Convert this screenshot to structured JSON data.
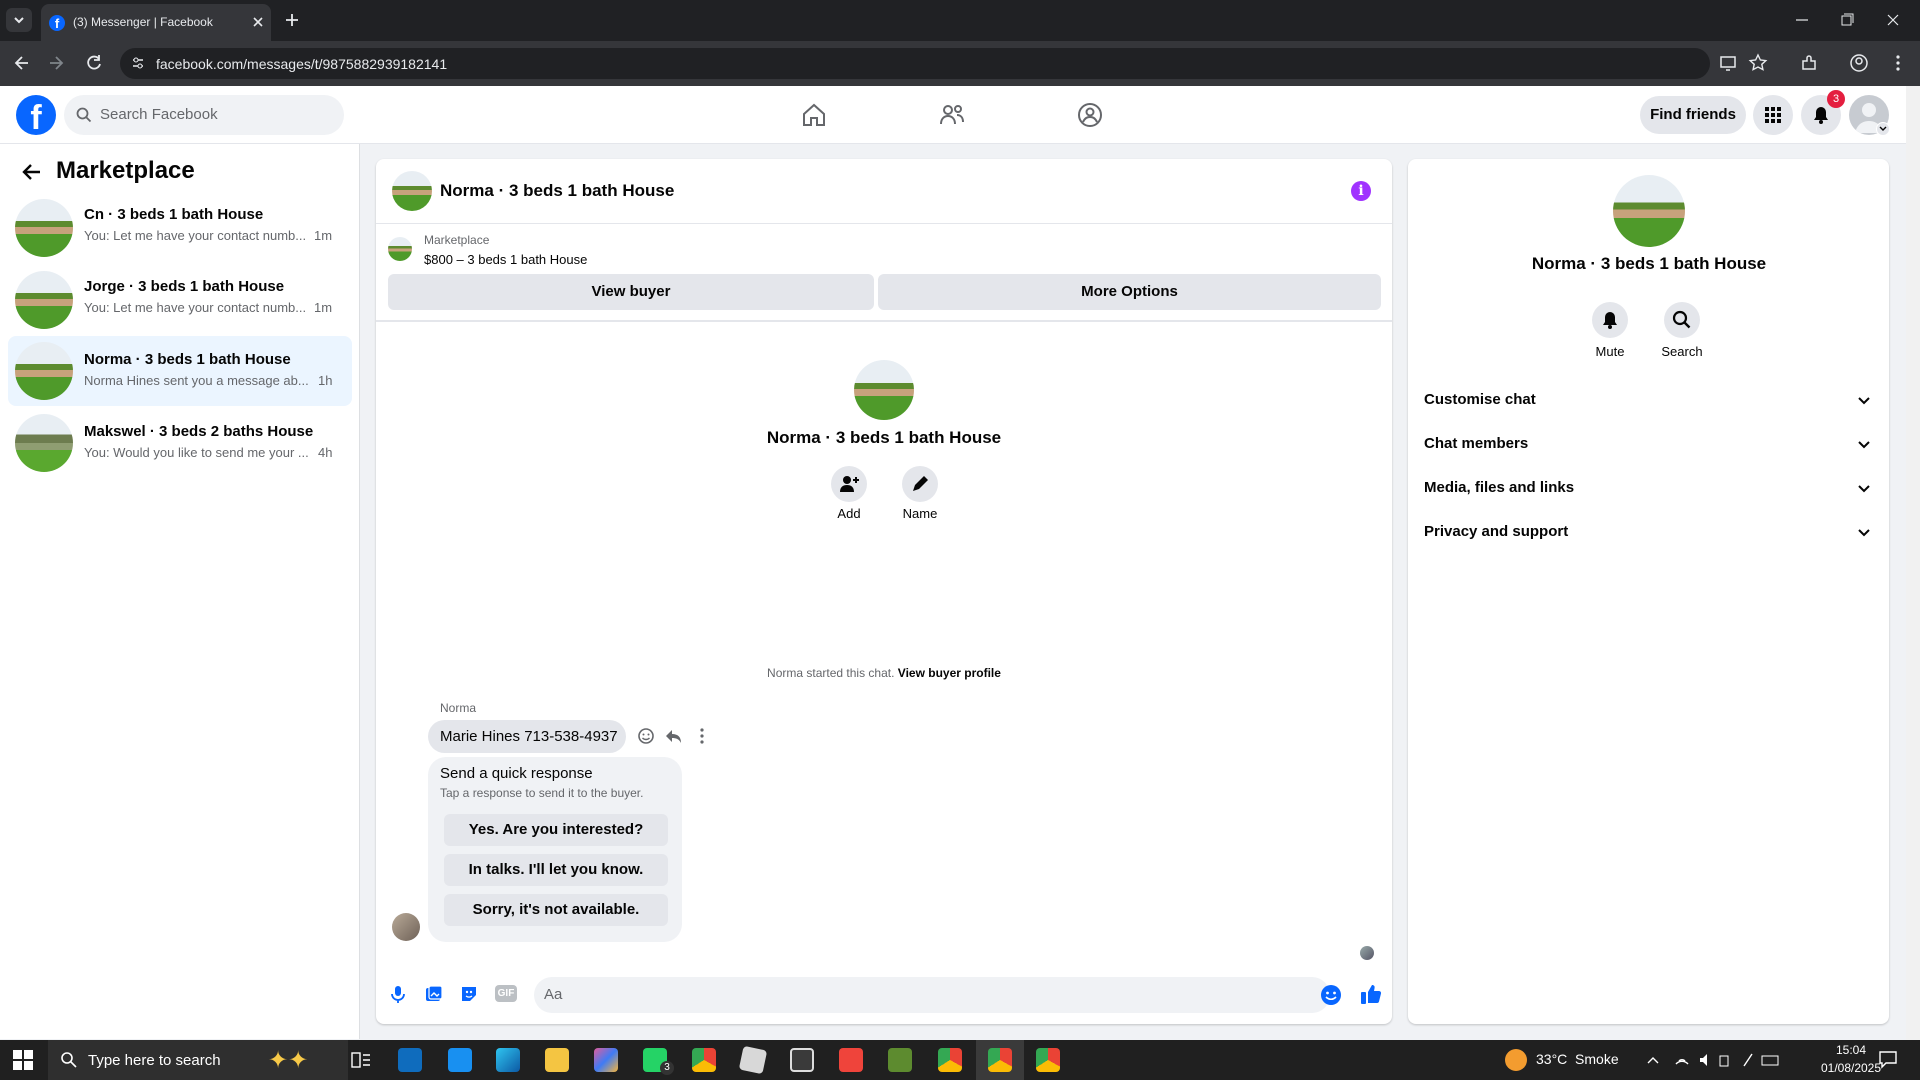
{
  "browser": {
    "tab_title": "(3) Messenger | Facebook",
    "url": "facebook.com/messages/t/9875882939182141"
  },
  "header": {
    "search_placeholder": "Search Facebook",
    "find_friends_label": "Find friends",
    "notification_count": "3"
  },
  "sidebar": {
    "title": "Marketplace",
    "conversations": [
      {
        "title": "Cn · 3 beds 1 bath House",
        "preview": "You: Let me have your contact numb...",
        "time": "1m"
      },
      {
        "title": "Jorge · 3 beds 1 bath House",
        "preview": "You: Let me have your contact numb...",
        "time": "1m"
      },
      {
        "title": "Norma · 3 beds 1 bath House",
        "preview": "Norma Hines sent you a message ab...",
        "time": "1h"
      },
      {
        "title": "Makswel · 3 beds 2 baths House",
        "preview": "You: Would you like to send me your ...",
        "time": "4h"
      }
    ]
  },
  "chat": {
    "title": "Norma · 3 beds 1 bath House",
    "listing_source": "Marketplace",
    "listing_text": "$800 – 3 beds 1 bath House",
    "view_buyer_label": "View buyer",
    "more_options_label": "More Options",
    "profile_name": "Norma · 3 beds 1 bath House",
    "add_label": "Add",
    "name_label": "Name",
    "started_text": "Norma started this chat.",
    "view_buyer_profile": "View buyer profile",
    "sender_name": "Norma",
    "message_text": "Marie Hines 713-538-4937",
    "quick_response_title": "Send a quick response",
    "quick_response_sub": "Tap a response to send it to the buyer.",
    "quick_responses": [
      "Yes. Are you interested?",
      "In talks. I'll let you know.",
      "Sorry, it's not available."
    ],
    "input_placeholder": "Aa",
    "gif_label": "GIF"
  },
  "details": {
    "name": "Norma · 3 beds 1 bath House",
    "mute_label": "Mute",
    "search_label": "Search",
    "sections": [
      "Customise chat",
      "Chat members",
      "Media, files and links",
      "Privacy and support"
    ]
  },
  "taskbar": {
    "search_placeholder": "Type here to search",
    "whatsapp_badge": "3",
    "weather": "33°C  Smoke",
    "time": "15:04",
    "date": "01/08/2025"
  },
  "colors": {
    "fb_blue": "#0866ff",
    "messenger_purple": "#a033ff",
    "badge_red": "#e41e3f"
  }
}
